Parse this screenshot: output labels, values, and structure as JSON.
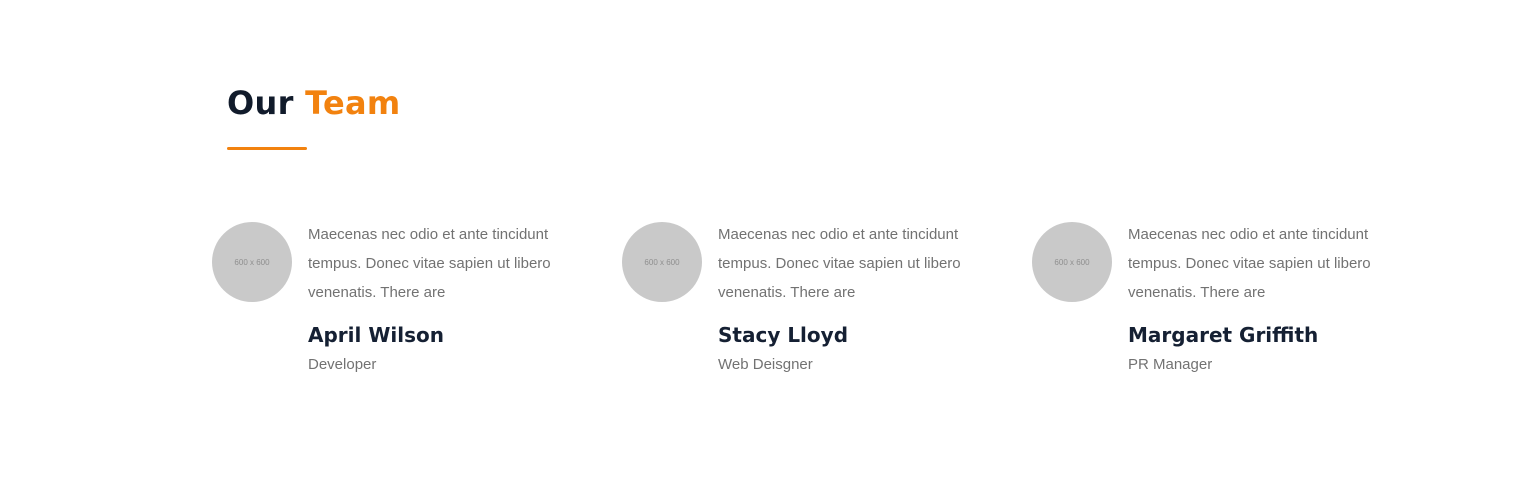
{
  "colors": {
    "accent": "#f2820f",
    "heading": "#111b2b",
    "text": "#727272",
    "avatar_placeholder": "#c9c9c9"
  },
  "section": {
    "title_prefix": "Our",
    "title_accent": "Team"
  },
  "team": [
    {
      "avatar_text": "600 x 600",
      "bio": "Maecenas nec odio et ante tincidunt tempus. Donec vitae sapien ut libero venenatis. There are",
      "name": "April Wilson",
      "role": "Developer"
    },
    {
      "avatar_text": "600 x 600",
      "bio": "Maecenas nec odio et ante tincidunt tempus. Donec vitae sapien ut libero venenatis. There are",
      "name": "Stacy Lloyd",
      "role": "Web Deisgner"
    },
    {
      "avatar_text": "600 x 600",
      "bio": "Maecenas nec odio et ante tincidunt tempus. Donec vitae sapien ut libero venenatis. There are",
      "name": "Margaret Griffith",
      "role": "PR Manager"
    }
  ]
}
